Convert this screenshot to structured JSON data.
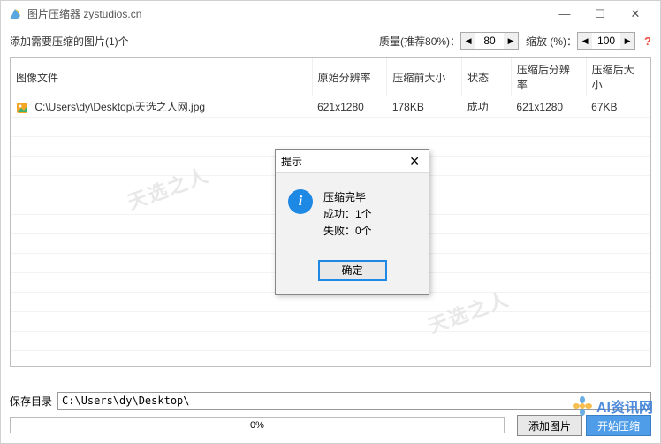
{
  "window": {
    "title": "图片压缩器 zystudios.cn"
  },
  "toolbar": {
    "add_label": "添加需要压缩的图片(1)个",
    "quality_label": "质量(推荐80%)：",
    "quality_value": "80",
    "scale_label": "缩放 (%)：",
    "scale_value": "100",
    "help": "?"
  },
  "columns": {
    "file": "图像文件",
    "orig_res": "原始分辨率",
    "orig_size": "压缩前大小",
    "status": "状态",
    "new_res": "压缩后分辨率",
    "new_size": "压缩后大小"
  },
  "rows": [
    {
      "file": "C:\\Users\\dy\\Desktop\\天选之人网.jpg",
      "orig_res": "621x1280",
      "orig_size": "178KB",
      "status": "成功",
      "new_res": "621x1280",
      "new_size": "67KB"
    }
  ],
  "save_dir": {
    "label": "保存目录",
    "value": "C:\\Users\\dy\\Desktop\\"
  },
  "progress": "0%",
  "buttons": {
    "add_image": "添加图片",
    "start": "开始压缩"
  },
  "dialog": {
    "title": "提示",
    "line1": "压缩完毕",
    "line2": "成功：1个",
    "line3": "失败：0个",
    "ok": "确定"
  },
  "watermark": {
    "text": "AI资讯网"
  }
}
